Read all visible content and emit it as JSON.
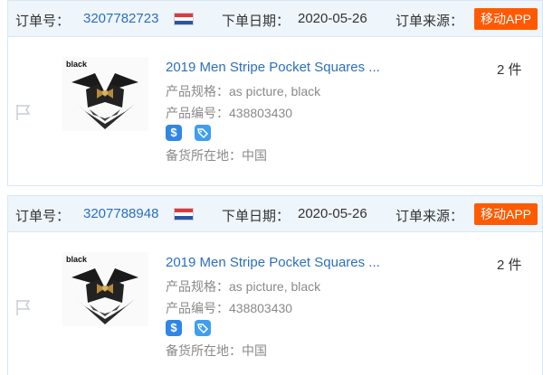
{
  "labels": {
    "order_no": "订单号：",
    "order_date": "下单日期：",
    "order_source": "订单来源：",
    "spec": "产品规格：",
    "product_code": "产品编号：",
    "ship_from": "备货所在地："
  },
  "orders": [
    {
      "order_no": "3207782723",
      "order_date": "2020-05-26",
      "source_badge": "移动APP",
      "product_title": "2019 Men Stripe Pocket Squares ...",
      "thumb_caption": "black",
      "spec_value": "as picture, black",
      "product_code": "438803430",
      "ship_from": "中国",
      "quantity": "2 件"
    },
    {
      "order_no": "3207788948",
      "order_date": "2020-05-26",
      "source_badge": "移动APP",
      "product_title": "2019 Men Stripe Pocket Squares ...",
      "thumb_caption": "black",
      "spec_value": "as picture, black",
      "product_code": "438803430",
      "ship_from": "中国",
      "quantity": "2 件"
    }
  ],
  "colors": {
    "header_bg": "#eef5fb",
    "link": "#2d6fbf",
    "badge": "#ff5a00",
    "muted": "#8a8a8a"
  },
  "icons": [
    "netherlands-flag-icon",
    "flag-icon",
    "dollar-icon",
    "tag-icon"
  ]
}
